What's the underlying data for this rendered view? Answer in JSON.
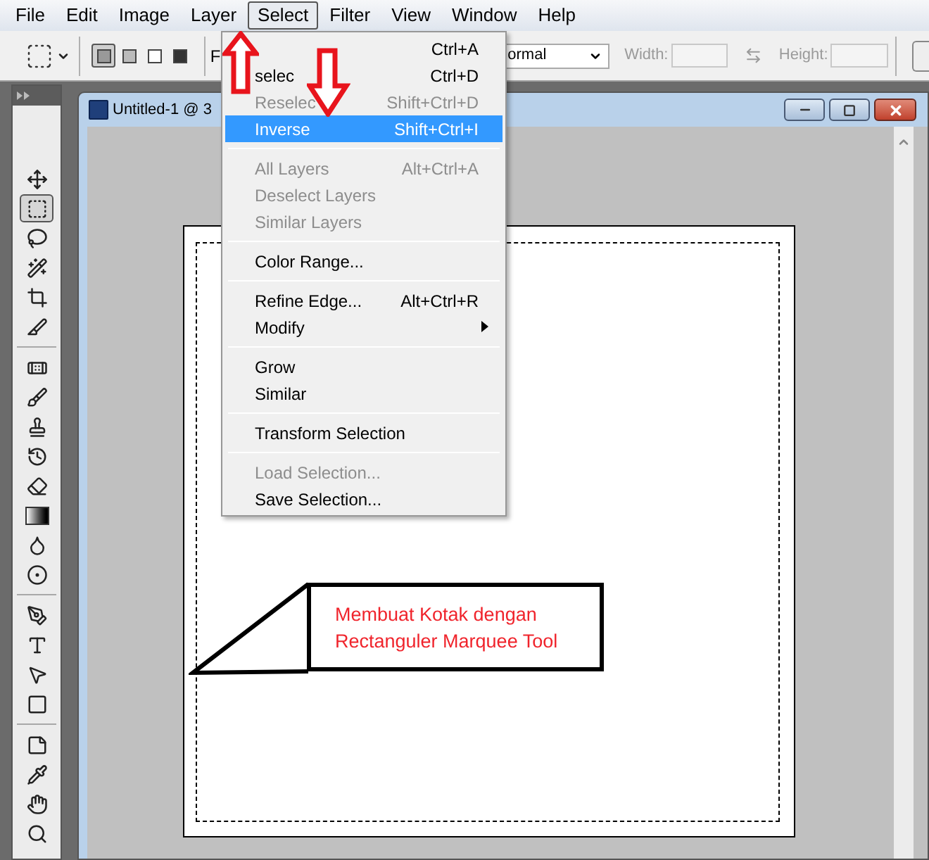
{
  "menu_bar": [
    {
      "label": "File",
      "selected": false
    },
    {
      "label": "Edit",
      "selected": false
    },
    {
      "label": "Image",
      "selected": false
    },
    {
      "label": "Layer",
      "selected": false
    },
    {
      "label": "Select",
      "selected": true
    },
    {
      "label": "Filter",
      "selected": false
    },
    {
      "label": "View",
      "selected": false
    },
    {
      "label": "Window",
      "selected": false
    },
    {
      "label": "Help",
      "selected": false
    }
  ],
  "options_bar": {
    "feather_label": "F",
    "style_value": "ormal",
    "width_label": "Width:",
    "height_label": "Height:"
  },
  "tools": [
    {
      "kind": "move",
      "selected": false
    },
    {
      "kind": "marquee",
      "selected": true
    },
    {
      "kind": "lasso",
      "selected": false
    },
    {
      "kind": "wand",
      "selected": false
    },
    {
      "kind": "crop",
      "selected": false
    },
    {
      "kind": "slice",
      "selected": false
    },
    {
      "kind": "separator"
    },
    {
      "kind": "healing",
      "selected": false
    },
    {
      "kind": "brush",
      "selected": false
    },
    {
      "kind": "stamp",
      "selected": false
    },
    {
      "kind": "history",
      "selected": false
    },
    {
      "kind": "eraser",
      "selected": false
    },
    {
      "kind": "gradient",
      "selected": false
    },
    {
      "kind": "blur",
      "selected": false
    },
    {
      "kind": "dodge",
      "selected": false
    },
    {
      "kind": "separator"
    },
    {
      "kind": "pen",
      "selected": false
    },
    {
      "kind": "type",
      "selected": false
    },
    {
      "kind": "path",
      "selected": false
    },
    {
      "kind": "shape",
      "selected": false
    },
    {
      "kind": "separator"
    },
    {
      "kind": "notes",
      "selected": false
    },
    {
      "kind": "eyedropper",
      "selected": false
    },
    {
      "kind": "hand",
      "selected": false
    },
    {
      "kind": "zoom",
      "selected": false
    }
  ],
  "document": {
    "title": "Untitled-1 @ 3"
  },
  "select_menu": [
    {
      "kind": "item",
      "shortcut": "Ctrl+A",
      "disabled": false,
      "selected": false
    },
    {
      "kind": "item",
      "label": "selec",
      "shortcut": "Ctrl+D",
      "disabled": false,
      "selected": false
    },
    {
      "kind": "item",
      "label": "Reselec",
      "shortcut": "Shift+Ctrl+D",
      "disabled": true,
      "selected": false
    },
    {
      "kind": "item",
      "label": "Inverse",
      "shortcut": "Shift+Ctrl+I",
      "disabled": false,
      "selected": true
    },
    {
      "kind": "separator"
    },
    {
      "kind": "item",
      "label": "All Layers",
      "shortcut": "Alt+Ctrl+A",
      "disabled": true,
      "selected": false
    },
    {
      "kind": "item",
      "label": "Deselect Layers",
      "disabled": true,
      "selected": false
    },
    {
      "kind": "item",
      "label": "Similar Layers",
      "disabled": true,
      "selected": false
    },
    {
      "kind": "separator"
    },
    {
      "kind": "item",
      "label": "Color Range...",
      "disabled": false,
      "selected": false
    },
    {
      "kind": "separator"
    },
    {
      "kind": "item",
      "label": "Refine Edge...",
      "shortcut": "Alt+Ctrl+R",
      "disabled": false,
      "selected": false
    },
    {
      "kind": "item",
      "label": "Modify",
      "disabled": false,
      "selected": false,
      "submenu": true
    },
    {
      "kind": "separator"
    },
    {
      "kind": "item",
      "label": "Grow",
      "disabled": false,
      "selected": false
    },
    {
      "kind": "item",
      "label": "Similar",
      "disabled": false,
      "selected": false
    },
    {
      "kind": "separator"
    },
    {
      "kind": "item",
      "label": "Transform Selection",
      "disabled": false,
      "selected": false
    },
    {
      "kind": "separator"
    },
    {
      "kind": "item",
      "label": "Load Selection...",
      "disabled": true,
      "selected": false
    },
    {
      "kind": "item",
      "label": "Save Selection...",
      "disabled": false,
      "selected": false
    }
  ],
  "callout": {
    "lines": [
      "Membuat Kotak dengan",
      "Rectanguler Marquee Tool"
    ]
  }
}
